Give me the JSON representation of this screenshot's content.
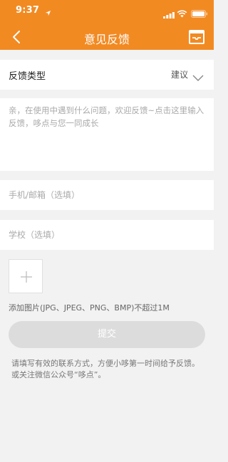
{
  "status_bar": {
    "time": "9:37"
  },
  "header": {
    "title": "意见反馈"
  },
  "feedback_type": {
    "label": "反馈类型",
    "value": "建议"
  },
  "feedback": {
    "placeholder": "亲，在使用中遇到什么问题，欢迎反馈~点击这里输入反馈，哆点与您一同成长",
    "value": ""
  },
  "contact": {
    "placeholder": "手机/邮箱（选填）",
    "value": ""
  },
  "school": {
    "placeholder": "学校（选填）",
    "value": ""
  },
  "image_upload": {
    "hint": "添加图片(JPG、JPEG、PNG、BMP)不超过1M"
  },
  "submit": {
    "label": "提交"
  },
  "footer_note": "请填写有效的联系方式，方便小哆第一时间给予反馈。或关注微信公众号“哆点”。",
  "colors": {
    "accent": "#f28a22",
    "background": "#f2f2f2",
    "button_disabled": "#dcdcdc"
  }
}
